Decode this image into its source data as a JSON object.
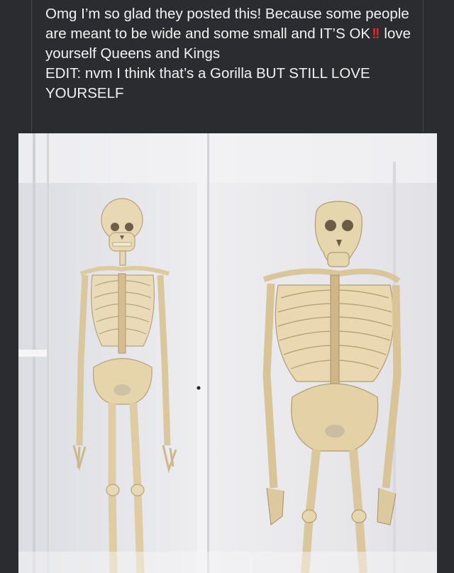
{
  "post": {
    "caption_line_1": "Omg I’m so glad they posted this! Because some people are meant to be wide and some small and IT’S OK",
    "caption_emoji": "!!",
    "caption_line_1b": " love yourself Queens and Kings",
    "caption_edit": "EDIT: nvm I think that’s a Gorilla BUT STILL LOVE YOURSELF"
  },
  "photo": {
    "subjects": [
      "human-skeleton",
      "gorilla-skeleton"
    ],
    "colors": {
      "background": "#2b2c30",
      "text": "#f2f2f2",
      "emoji": "#e0262b",
      "bone": "#e6d6b0",
      "display_case": "#e9e8ea"
    }
  }
}
